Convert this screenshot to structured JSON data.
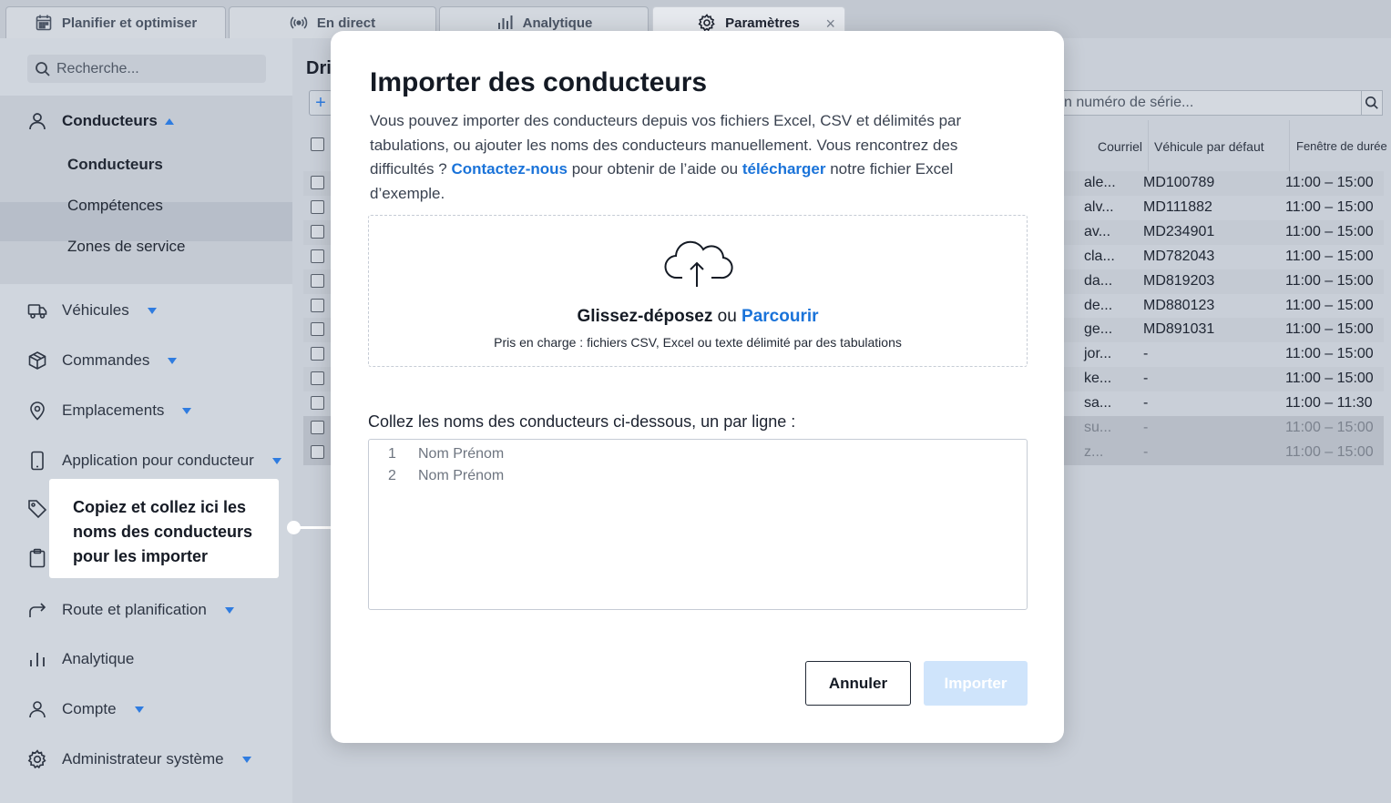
{
  "tabs": [
    {
      "label": "Planifier et optimiser",
      "icon": "calendar-icon"
    },
    {
      "label": "En direct",
      "icon": "broadcast-icon"
    },
    {
      "label": "Analytique",
      "icon": "bar-chart-icon"
    },
    {
      "label": "Paramètres",
      "icon": "gear-icon",
      "active": true
    }
  ],
  "sidebar": {
    "search_placeholder": "Recherche...",
    "drivers": {
      "label": "Conducteurs",
      "sub": [
        "Conducteurs",
        "Compétences",
        "Zones de service"
      ]
    },
    "items": [
      {
        "label": "Véhicules",
        "icon": "truck-icon",
        "caret": true
      },
      {
        "label": "Commandes",
        "icon": "package-icon",
        "caret": true
      },
      {
        "label": "Emplacements",
        "icon": "location-pin-icon",
        "caret": true
      },
      {
        "label": "Application pour conducteur",
        "icon": "phone-icon",
        "caret": true
      },
      {
        "label": "Route et planification",
        "icon": "route-arrow-icon",
        "caret": true
      },
      {
        "label": "Analytique",
        "icon": "bar-chart-icon",
        "caret": false
      },
      {
        "label": "Compte",
        "icon": "user-icon",
        "caret": true
      },
      {
        "label": "Administrateur système",
        "icon": "gear-icon",
        "caret": true
      }
    ]
  },
  "tooltip": {
    "text": "Copiez et collez ici les noms des conducteurs pour les importer"
  },
  "main": {
    "title_partial": "Dri",
    "add_label": "+",
    "serial_search_placeholder": "n numéro de série...",
    "columns": [
      "Courriel",
      "Véhicule par défaut",
      "Fenêtre de durée"
    ],
    "rows": [
      {
        "email": "ale...",
        "vehicle": "MD100789",
        "window": "11:00 – 15:00"
      },
      {
        "email": "alv...",
        "vehicle": "MD111882",
        "window": "11:00 – 15:00"
      },
      {
        "email": "av...",
        "vehicle": "MD234901",
        "window": "11:00 – 15:00"
      },
      {
        "email": "cla...",
        "vehicle": "MD782043",
        "window": "11:00 – 15:00"
      },
      {
        "email": "da...",
        "vehicle": "MD819203",
        "window": "11:00 – 15:00"
      },
      {
        "email": "de...",
        "vehicle": "MD880123",
        "window": "11:00 – 15:00"
      },
      {
        "email": "ge...",
        "vehicle": "MD891031",
        "window": "11:00 – 15:00"
      },
      {
        "email": "jor...",
        "vehicle": "-",
        "window": "11:00 – 15:00"
      },
      {
        "email": "ke...",
        "vehicle": "-",
        "window": "11:00 – 15:00"
      },
      {
        "email": "sa...",
        "vehicle": "-",
        "window": "11:00 – 11:30"
      },
      {
        "email": "su...",
        "vehicle": "-",
        "window": "11:00 – 15:00",
        "disabled": true
      },
      {
        "email": "z...",
        "vehicle": "-",
        "window": "11:00 – 15:00",
        "disabled": true
      }
    ]
  },
  "modal": {
    "title": "Importer des conducteurs",
    "desc_part1": "Vous pouvez importer des conducteurs depuis vos fichiers Excel, CSV et délimités par tabulations, ou ajouter les noms des conducteurs manuellement. Vous rencontrez des difficultés ? ",
    "contact_link": "Contactez-nous",
    "desc_part2": " pour obtenir de l’aide ou ",
    "download_link": "télécharger",
    "desc_part3": " notre fichier Excel d’exemple.",
    "dropzone": {
      "drag_label": "Glissez-déposez",
      "or_label": " ou ",
      "browse_link": "Parcourir",
      "supported": "Pris en charge : fichiers CSV, Excel ou texte délimité par des tabulations"
    },
    "paste_label": "Collez les noms des conducteurs ci-dessous, un par ligne :",
    "textarea_lines": [
      {
        "num": "1",
        "text": "Nom Prénom"
      },
      {
        "num": "2",
        "text": "Nom Prénom"
      }
    ],
    "cancel_label": "Annuler",
    "import_label": "Importer"
  },
  "colors": {
    "accent": "#1a73d9",
    "import_disabled_bg": "#cfe4fb",
    "overlay": "#c9cfd8"
  }
}
